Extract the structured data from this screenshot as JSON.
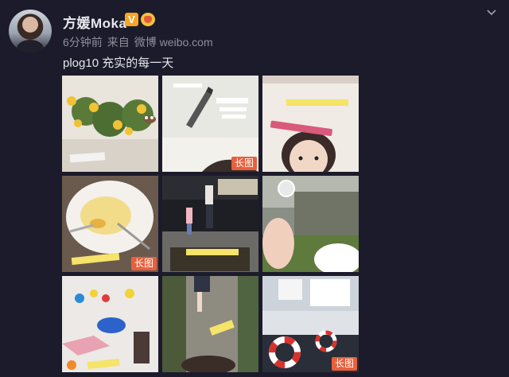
{
  "author": {
    "name": "方媛Moka",
    "verified_icon": "verified-v-icon",
    "member_icon": "crown-badge-icon"
  },
  "meta": {
    "time": "6分钟前",
    "source_prefix": "来自",
    "source": "微博 weibo.com"
  },
  "post": {
    "text": "plog10 充实的每一天"
  },
  "images": [
    {
      "desc": "sunflowers-on-table",
      "long": false
    },
    {
      "desc": "pen-closeup",
      "long": true,
      "tag": "长图"
    },
    {
      "desc": "girl-selfie-with-pen",
      "long": false
    },
    {
      "desc": "omelette-plate",
      "long": true,
      "tag": "长图"
    },
    {
      "desc": "night-walk",
      "long": false
    },
    {
      "desc": "dandelion-hand",
      "long": false
    },
    {
      "desc": "painting-craft",
      "long": false
    },
    {
      "desc": "stone-path",
      "long": false
    },
    {
      "desc": "lifebuoy-display",
      "long": true,
      "tag": "长图"
    }
  ],
  "colors": {
    "background": "#1c1b2b",
    "name": "#e8e8ee",
    "meta": "#8e8e9a",
    "long_tag": "#e8603c",
    "verified": "#f6a623"
  }
}
